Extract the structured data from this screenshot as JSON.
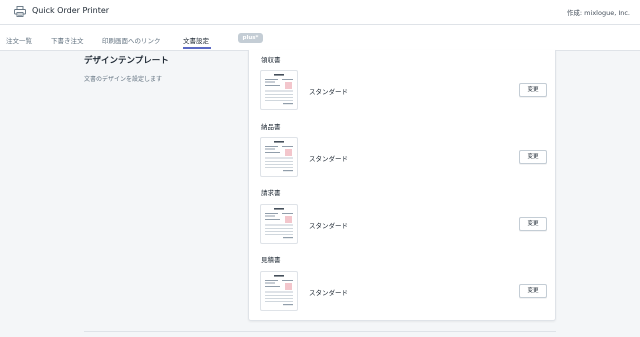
{
  "app": {
    "title": "Quick Order Printer",
    "author": "作成: mixlogue, Inc."
  },
  "nav": {
    "tabs": [
      {
        "label": "注文一覧"
      },
      {
        "label": "下書き注文"
      },
      {
        "label": "印刷画面へのリンク"
      },
      {
        "label": "文書設定",
        "active": true
      }
    ],
    "badge": "plus*"
  },
  "section": {
    "title": "デザインテンプレート",
    "description": "文書のデザインを設定します"
  },
  "documents": [
    {
      "label": "領収書",
      "template": "スタンダード",
      "button": "変更"
    },
    {
      "label": "納品書",
      "template": "スタンダード",
      "button": "変更"
    },
    {
      "label": "請求書",
      "template": "スタンダード",
      "button": "変更"
    },
    {
      "label": "見積書",
      "template": "スタンダード",
      "button": "変更"
    }
  ],
  "colors": {
    "accent": "#5c6ac4",
    "border": "#dfe3e8",
    "background": "#f4f6f8",
    "stamp": "#e8a0a8"
  }
}
